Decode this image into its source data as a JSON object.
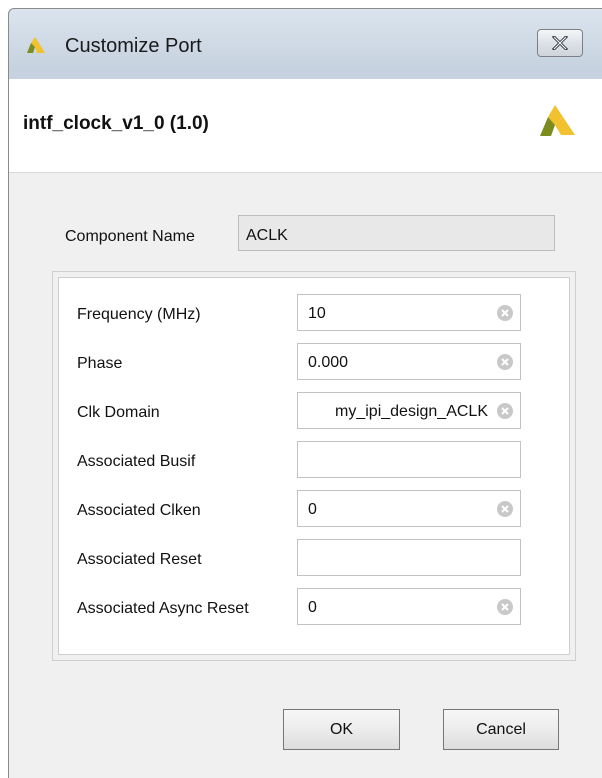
{
  "window": {
    "title": "Customize Port",
    "close_icon": "close-x-icon",
    "logo_icon": "xilinx-logo-icon"
  },
  "header": {
    "ip_title": "intf_clock_v1_0 (1.0)",
    "logo_icon": "xilinx-logo-icon"
  },
  "component": {
    "label": "Component Name",
    "value": "ACLK"
  },
  "parameters": [
    {
      "label": "Frequency (MHz)",
      "value": "10",
      "clearable": true
    },
    {
      "label": "Phase",
      "value": "0.000",
      "clearable": true
    },
    {
      "label": "Clk Domain",
      "value": "my_ipi_design_ACLK",
      "clearable": true
    },
    {
      "label": "Associated Busif",
      "value": "",
      "clearable": false
    },
    {
      "label": "Associated Clken",
      "value": "0",
      "clearable": true
    },
    {
      "label": "Associated Reset",
      "value": "",
      "clearable": false
    },
    {
      "label": "Associated Async Reset",
      "value": "0",
      "clearable": true
    }
  ],
  "buttons": {
    "ok": "OK",
    "cancel": "Cancel"
  },
  "colors": {
    "logo_yellow": "#f2c12e",
    "logo_olive": "#7d8c1e",
    "clear_icon": "#c8c8c8"
  }
}
